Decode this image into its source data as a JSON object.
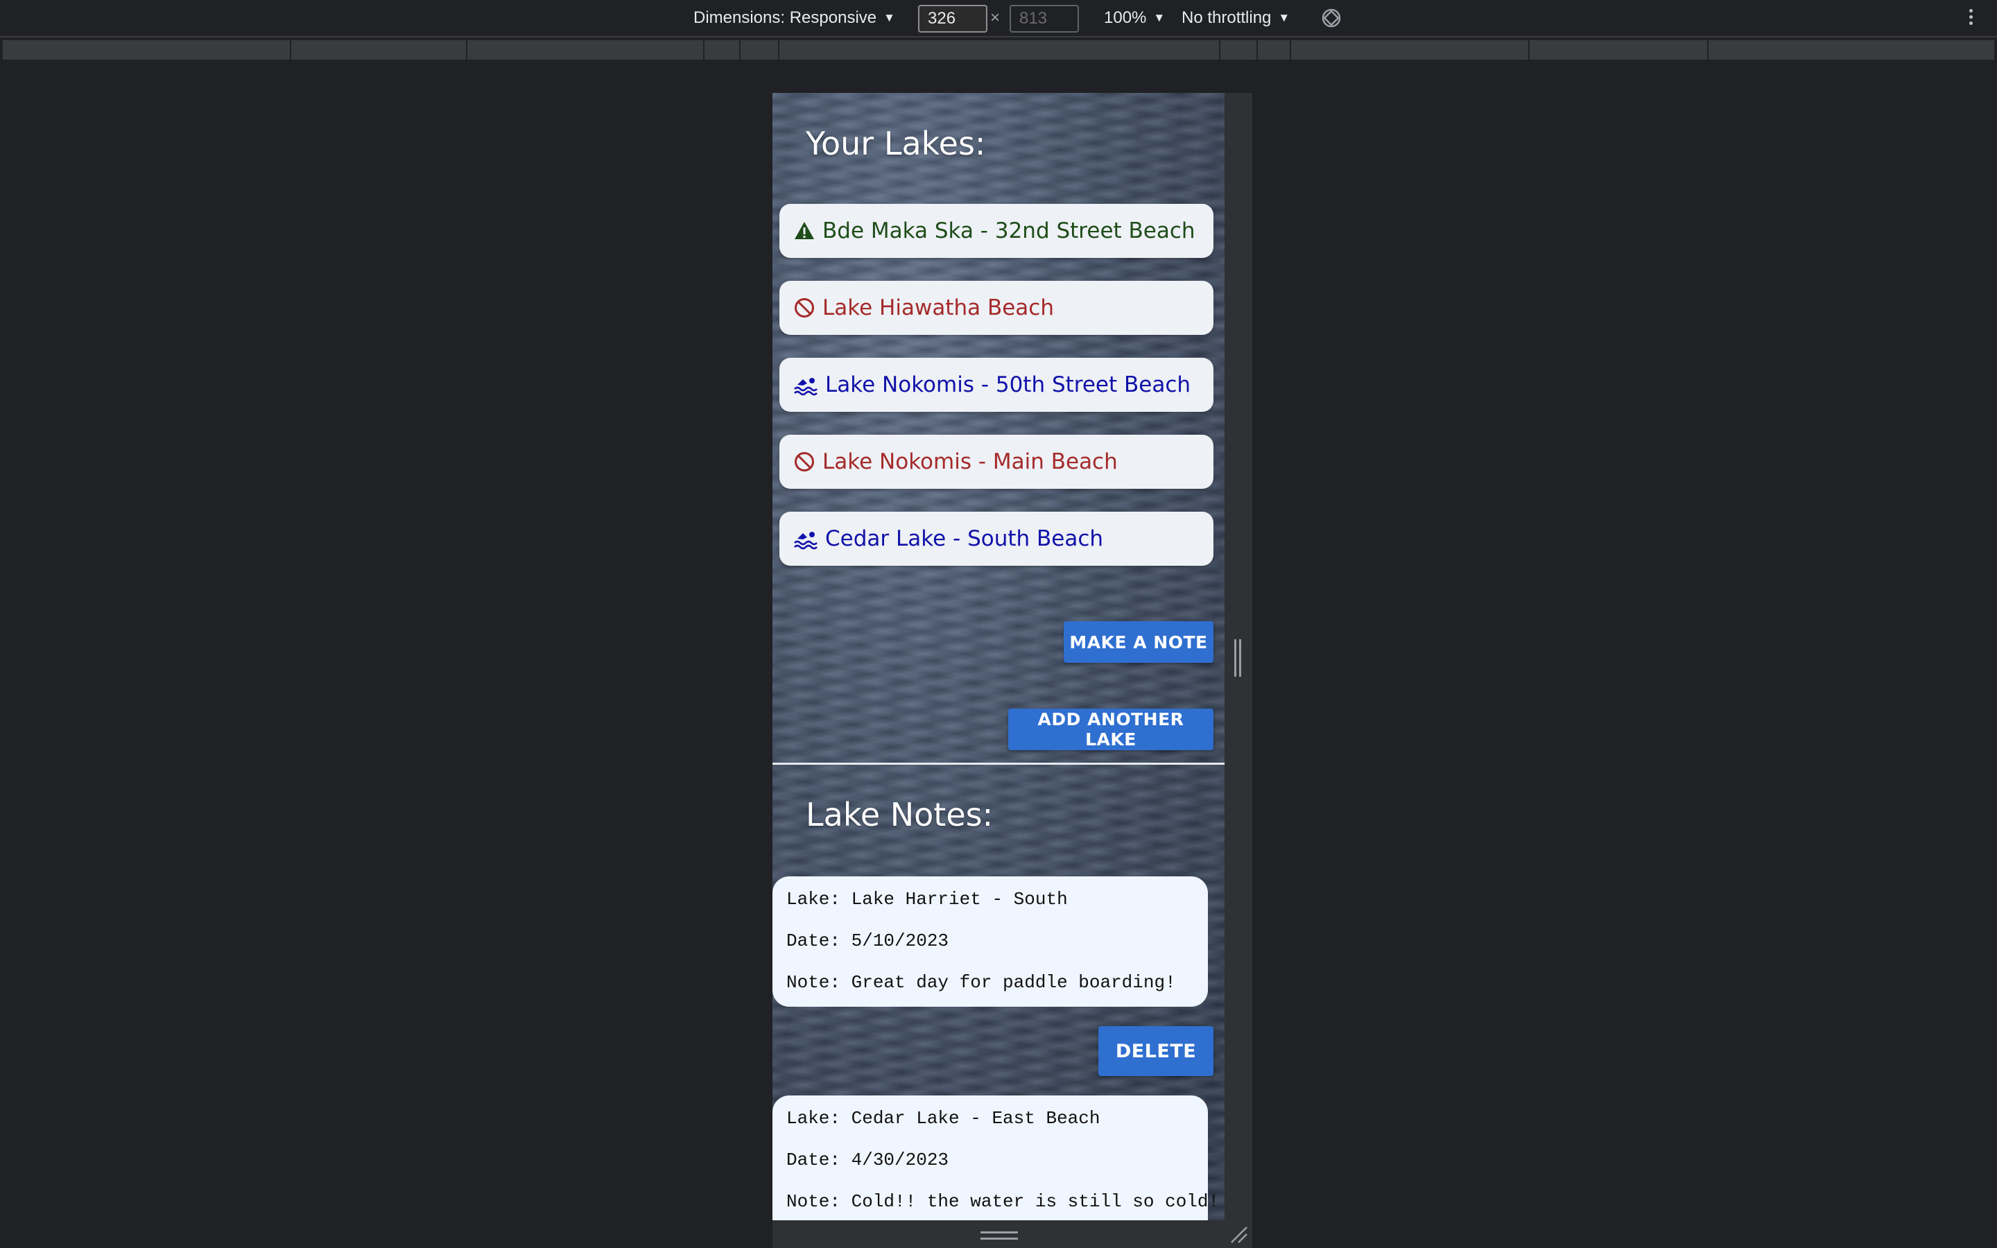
{
  "devtools": {
    "dimensions_label": "Dimensions: Responsive",
    "width_value": "326",
    "height_value": "813",
    "times_symbol": "×",
    "zoom_label": "100%",
    "throttling_label": "No throttling",
    "caret": "▼"
  },
  "app": {
    "lakes_title": "Your Lakes:",
    "lakes": [
      {
        "name": "Bde Maka Ska - 32nd Street Beach",
        "status_icon": "warning-icon",
        "color": "#1f4d1a"
      },
      {
        "name": "Lake Hiawatha Beach",
        "status_icon": "prohibited-icon",
        "color": "#a52a2a"
      },
      {
        "name": "Lake Nokomis - 50th Street Beach",
        "status_icon": "swimmer-icon",
        "color": "#1111aa"
      },
      {
        "name": "Lake Nokomis - Main Beach",
        "status_icon": "prohibited-icon",
        "color": "#a52a2a"
      },
      {
        "name": "Cedar Lake - South Beach",
        "status_icon": "swimmer-icon",
        "color": "#1111aa"
      }
    ],
    "make_note_label": "MAKE A NOTE",
    "add_lake_label": "ADD ANOTHER LAKE",
    "notes_title": "Lake Notes:",
    "notes": [
      {
        "lake": "Lake: Lake Harriet - South",
        "date": "Date: 5/10/2023",
        "note": "Note: Great day for paddle boarding!"
      },
      {
        "lake": "Lake: Cedar Lake - East Beach",
        "date": "Date: 4/30/2023",
        "note": "Note: Cold!! the water is still so cold!"
      }
    ],
    "delete_label": "DELETE",
    "accent_color": "#2f6fd0"
  }
}
